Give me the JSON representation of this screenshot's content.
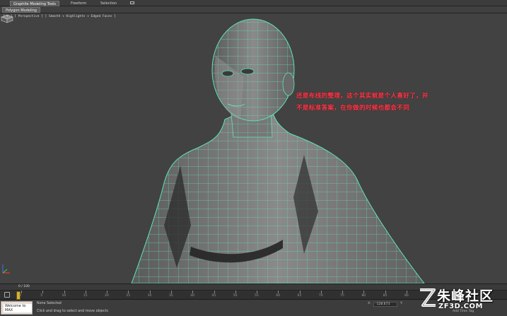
{
  "ribbon": {
    "tabs": [
      {
        "label": "Graphite Modeling Tools",
        "active": true
      },
      {
        "label": "Freeform",
        "active": false
      },
      {
        "label": "Selection",
        "active": false
      }
    ]
  },
  "subbar": {
    "tab_label": "Polygon Modeling"
  },
  "viewport": {
    "label": "[ + ] [ Perspective ] [ Smooth + Highlights + Edged Faces ]",
    "annotation_line1": "还是布线的整理，这个其实就是个人喜好了，并",
    "annotation_line2": "不是标准答案，在你做的时候也都会不同",
    "annotation_color": "#ff3c4e",
    "wire_color": "#5fe6b4"
  },
  "timebar": {
    "frame_indicator": "0 / 100"
  },
  "timeline": {
    "ticks": [
      "0",
      "5",
      "10",
      "15",
      "20",
      "25",
      "30",
      "35",
      "40",
      "45",
      "50",
      "55",
      "60",
      "65",
      "70",
      "75",
      "80",
      "85",
      "90"
    ]
  },
  "status": {
    "welcome": "Welcome to MAX",
    "line1": "None Selected",
    "line2": "Click and drag to select and move objects",
    "x_label": "X:",
    "x_value": "-128.673",
    "y_label": "Y:",
    "add_time_tag": "Add Time Tag"
  },
  "watermark": {
    "text": "朱峰社区",
    "url": "ZF3D.COM"
  }
}
